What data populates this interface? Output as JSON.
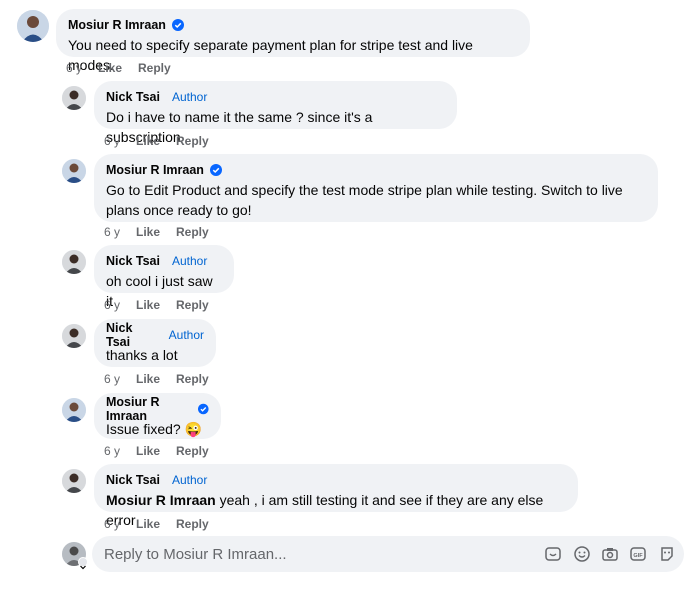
{
  "comments": [
    {
      "author": "Mosiur R Imraan",
      "verified": true,
      "badge": "",
      "text": "You need to specify separate payment plan for stripe test and live modes.",
      "age": "6 y",
      "like": "Like",
      "reply": "Reply"
    },
    {
      "author": "Nick Tsai",
      "verified": false,
      "badge": "Author",
      "text": "Do i have to name it the same ? since it's a subscription",
      "age": "6 y",
      "like": "Like",
      "reply": "Reply"
    },
    {
      "author": "Mosiur R Imraan",
      "verified": true,
      "badge": "",
      "text_line1": "Go to Edit Product and specify the test mode stripe plan while testing. Switch to live",
      "text_line2": "plans once ready to go!",
      "age": "6 y",
      "like": "Like",
      "reply": "Reply"
    },
    {
      "author": "Nick Tsai",
      "verified": false,
      "badge": "Author",
      "text": "oh cool i just saw it",
      "age": "6 y",
      "like": "Like",
      "reply": "Reply"
    },
    {
      "author": "Nick Tsai",
      "verified": false,
      "badge": "Author",
      "text": "thanks a lot",
      "age": "6 y",
      "like": "Like",
      "reply": "Reply"
    },
    {
      "author": "Mosiur R Imraan",
      "verified": true,
      "badge": "",
      "text": "Issue fixed? ",
      "emoji": "😜",
      "age": "6 y",
      "like": "Like",
      "reply": "Reply"
    },
    {
      "author": "Nick Tsai",
      "verified": false,
      "badge": "Author",
      "mention": "Mosiur R Imraan",
      "text": " yeah , i am still testing it and see if they are any else error",
      "age": "6 y",
      "like": "Like",
      "reply": "Reply"
    }
  ],
  "reply_box": {
    "placeholder": "Reply to Mosiur R Imraan...",
    "tools": [
      "sticker-icon",
      "emoji-icon",
      "camera-icon",
      "gif-icon",
      "avatar-sticker-icon"
    ]
  },
  "colors": {
    "bubble": "#f0f2f5",
    "verified": "#0866ff",
    "author_badge": "#0064d1",
    "meta": "#65676b"
  }
}
